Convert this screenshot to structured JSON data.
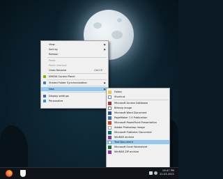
{
  "context_menu": {
    "items": [
      {
        "label": "View",
        "has_submenu": true
      },
      {
        "label": "Sort by",
        "has_submenu": true
      },
      {
        "label": "Refresh"
      },
      {
        "label": "Paste",
        "disabled": true
      },
      {
        "label": "Paste shortcut",
        "disabled": true
      },
      {
        "label": "Undo Rename",
        "shortcut": "Ctrl+Z"
      },
      {
        "label": "NVIDIA Control Panel",
        "icon": "nvidia-icon"
      },
      {
        "label": "Shared Folder Synchronization",
        "icon": "sync-folder-icon",
        "has_submenu": true
      },
      {
        "label": "New",
        "has_submenu": true,
        "highlighted": true
      },
      {
        "label": "Display settings",
        "icon": "display-icon"
      },
      {
        "label": "Personalize",
        "icon": "personalize-icon"
      }
    ]
  },
  "new_submenu": {
    "items": [
      {
        "label": "Folder",
        "icon": "folder-icon"
      },
      {
        "label": "Shortcut",
        "icon": "shortcut-icon"
      },
      {
        "label": "Microsoft Access Database",
        "icon": "access-icon"
      },
      {
        "label": "Bitmap image",
        "icon": "bitmap-icon"
      },
      {
        "label": "Microsoft Word Document",
        "icon": "word-icon"
      },
      {
        "label": "PageMaker 7.0 Publication",
        "icon": "pagemaker-icon"
      },
      {
        "label": "Microsoft PowerPoint Presentation",
        "icon": "powerpoint-icon"
      },
      {
        "label": "Adobe Photoshop Image",
        "icon": "photoshop-icon"
      },
      {
        "label": "Microsoft Publisher Document",
        "icon": "publisher-icon"
      },
      {
        "label": "WinRAR archive",
        "icon": "winrar-icon"
      },
      {
        "label": "Text Document",
        "icon": "text-document-icon",
        "highlighted": true
      },
      {
        "label": "Microsoft Excel Worksheet",
        "icon": "excel-icon"
      },
      {
        "label": "WinRAR ZIP archive",
        "icon": "winrar-zip-icon"
      }
    ]
  },
  "taskbar": {
    "time": "05:47 PM",
    "date": "22-03-2021"
  },
  "colors": {
    "menu_bg": "#f0f0f0",
    "highlight": "#91c9f7",
    "taskbar_bg": "#101418"
  }
}
